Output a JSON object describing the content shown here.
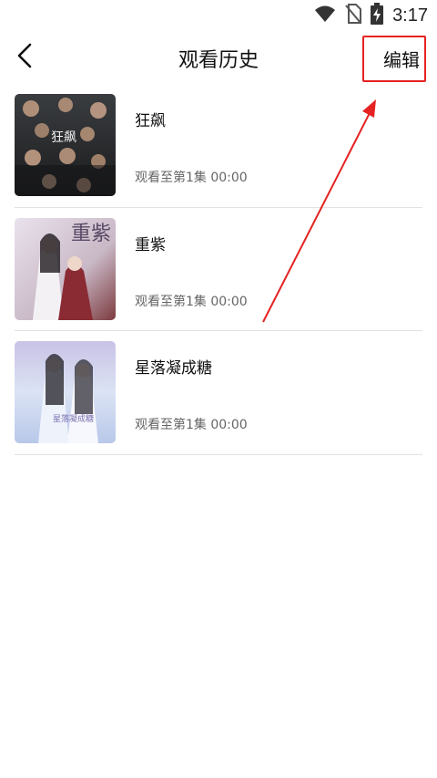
{
  "status_bar": {
    "time": "3:17",
    "icons": [
      "wifi-icon",
      "no-sim-icon",
      "battery-charging-icon"
    ]
  },
  "header": {
    "back_icon": "chevron-left-icon",
    "title": "观看历史",
    "edit_label": "编辑"
  },
  "history": [
    {
      "title": "狂飙",
      "progress": "观看至第1集  00:00",
      "poster_text": "狂飙"
    },
    {
      "title": "重紫",
      "progress": "观看至第1集  00:00",
      "poster_text": "重紫"
    },
    {
      "title": "星落凝成糖",
      "progress": "观看至第1集  00:00",
      "poster_text": "星落凝成糖"
    }
  ],
  "colors": {
    "annotation_red": "#e52222",
    "divider": "#e2e2e2",
    "secondary_text": "#666666"
  }
}
